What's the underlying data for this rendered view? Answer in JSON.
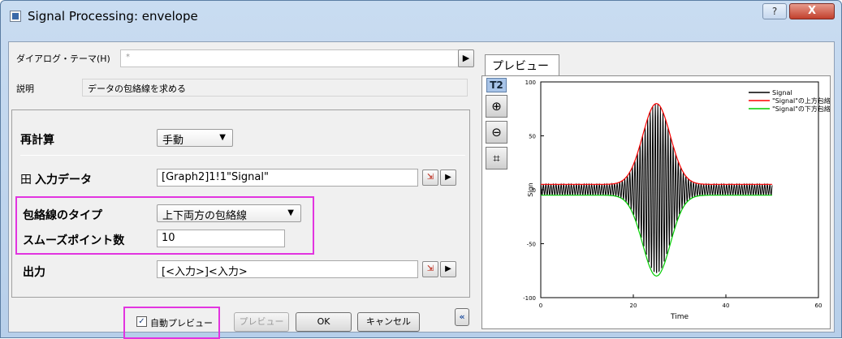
{
  "window": {
    "title": "Signal Processing: envelope",
    "help_label": "?",
    "close_label": "X"
  },
  "header": {
    "theme_label": "ダイアログ・テーマ(H)",
    "theme_value": "*",
    "theme_arrow": "▶",
    "description_label": "説明",
    "description_value": "データの包絡線を求める"
  },
  "settings": {
    "recalc_label": "再計算",
    "recalc_value": "手動",
    "input_expander": "田",
    "input_label": "入力データ",
    "input_value": "[Graph2]1!1\"Signal\"",
    "envelope_type_label": "包絡線のタイプ",
    "envelope_type_value": "上下両方の包絡線",
    "smooth_points_label": "スムーズポイント数",
    "smooth_points_value": "10",
    "output_label": "出力",
    "output_value": "[<入力>]<入力>",
    "caret": "▼",
    "arrow": "▶"
  },
  "footer": {
    "auto_preview_label": "自動プレビュー",
    "auto_preview_checked": true,
    "preview_button": "プレビュー",
    "ok_button": "OK",
    "cancel_button": "キャンセル",
    "collapse_button": "«"
  },
  "preview": {
    "tab_label": "プレビュー",
    "layer_label": "T2"
  },
  "chart_data": {
    "type": "line",
    "xlabel": "Time",
    "ylabel": "Sign",
    "xlim": [
      0,
      60
    ],
    "ylim": [
      -100,
      100
    ],
    "x_ticks": [
      "0",
      "20",
      "40",
      "60"
    ],
    "y_ticks": [
      "100",
      "50",
      "0",
      "-50",
      "-100"
    ],
    "legend_position": "top-right",
    "series": [
      {
        "name": "Signal",
        "color": "#000000",
        "description_values": {
          "x_start": 0,
          "x_end": 50,
          "center": 25,
          "peak_amplitude": 80,
          "baseline_amplitude": 5
        }
      },
      {
        "name": "\"Signal\"の上方包絡線",
        "color": "#ff0000",
        "x": [
          0,
          10,
          15,
          20,
          22,
          25,
          28,
          30,
          35,
          40,
          50
        ],
        "y": [
          5,
          5,
          10,
          45,
          65,
          80,
          65,
          45,
          10,
          5,
          5
        ]
      },
      {
        "name": "\"Signal\"の下方包絡線",
        "color": "#00cc00",
        "x": [
          0,
          10,
          15,
          20,
          22,
          25,
          28,
          30,
          35,
          40,
          50
        ],
        "y": [
          -5,
          -5,
          -10,
          -45,
          -65,
          -80,
          -65,
          -45,
          -10,
          -5,
          -5
        ]
      }
    ]
  }
}
